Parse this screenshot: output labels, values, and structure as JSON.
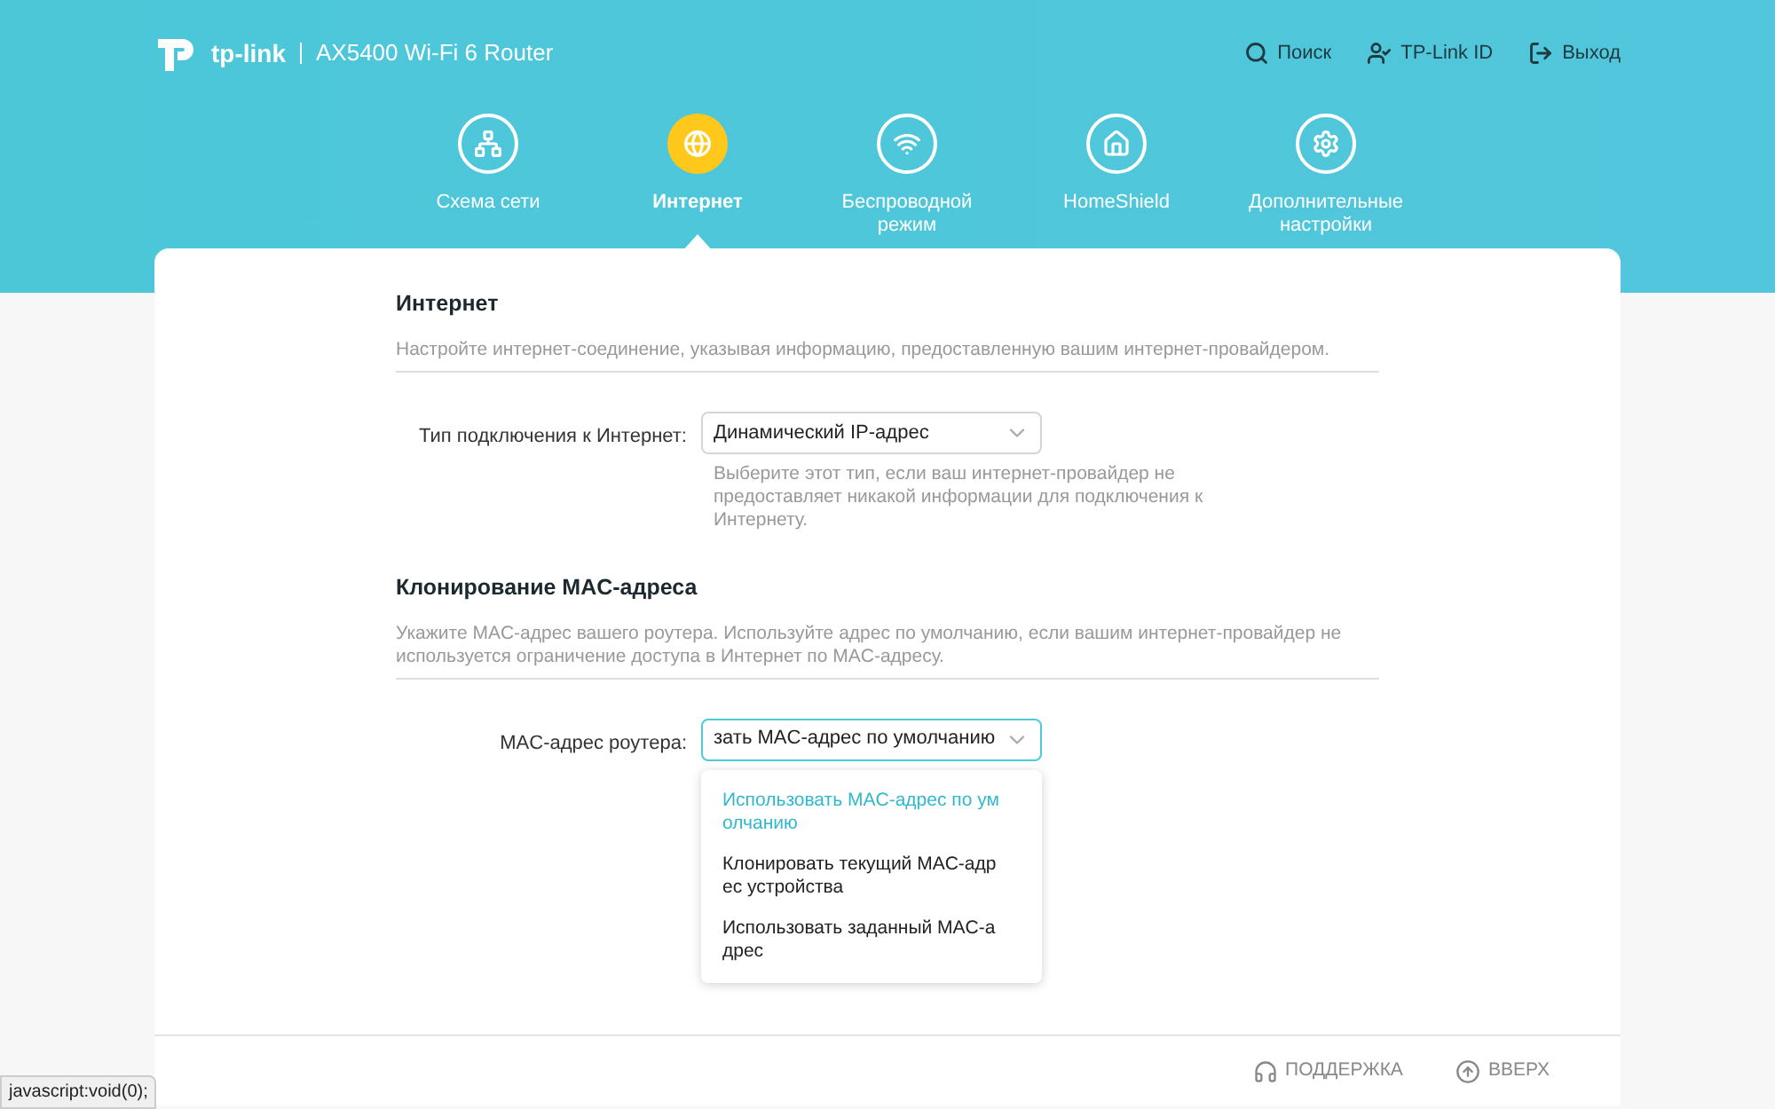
{
  "header": {
    "brand": "tp-link",
    "model": "AX5400 Wi-Fi 6 Router",
    "links": [
      {
        "label": "Поиск"
      },
      {
        "label": "TP-Link ID"
      },
      {
        "label": "Выход"
      }
    ]
  },
  "nav": [
    {
      "label": "Схема сети",
      "selected": false
    },
    {
      "label": "Интернет",
      "selected": true
    },
    {
      "label": "Беспроводной режим",
      "selected": false
    },
    {
      "label": "HomeShield",
      "selected": false
    },
    {
      "label": "Дополнительные настройки",
      "selected": false
    }
  ],
  "sections": [
    {
      "title": "Интернет",
      "description": "Настройте интернет-соединение, указывая информацию, предоставленную вашим интернет-провайдером.",
      "field": {
        "label": "Тип подключения к Интернет:",
        "value": "Динамический IP-адрес",
        "focused": false,
        "hint": "Выберите этот тип, если ваш интернет-провайдер не предоставляет никакой информации для подключения к Интернету."
      }
    },
    {
      "title": "Клонирование MAC-адреса",
      "description": "Укажите MAC-адрес вашего роутера. Используйте адрес по умолчанию, если вашим интернет-провайдер не используется ограничение доступа в Интернет по MAC-адресу.",
      "field": {
        "label": "MAC-адрес роутера:",
        "value": "зать MAC-адрес по умолчанию",
        "focused": true,
        "options": [
          {
            "label": "Использовать MAC-адрес по умолчанию",
            "selected": true
          },
          {
            "label": "Клонировать текущий MAC-адрес устройства",
            "selected": false
          },
          {
            "label": "Использовать заданный MAC-адрес",
            "selected": false
          }
        ]
      }
    }
  ],
  "footer": {
    "links": [
      {
        "label": "ПОДДЕРЖКА"
      },
      {
        "label": "ВВЕРХ"
      }
    ]
  },
  "status_bar": "javascript:void(0);"
}
